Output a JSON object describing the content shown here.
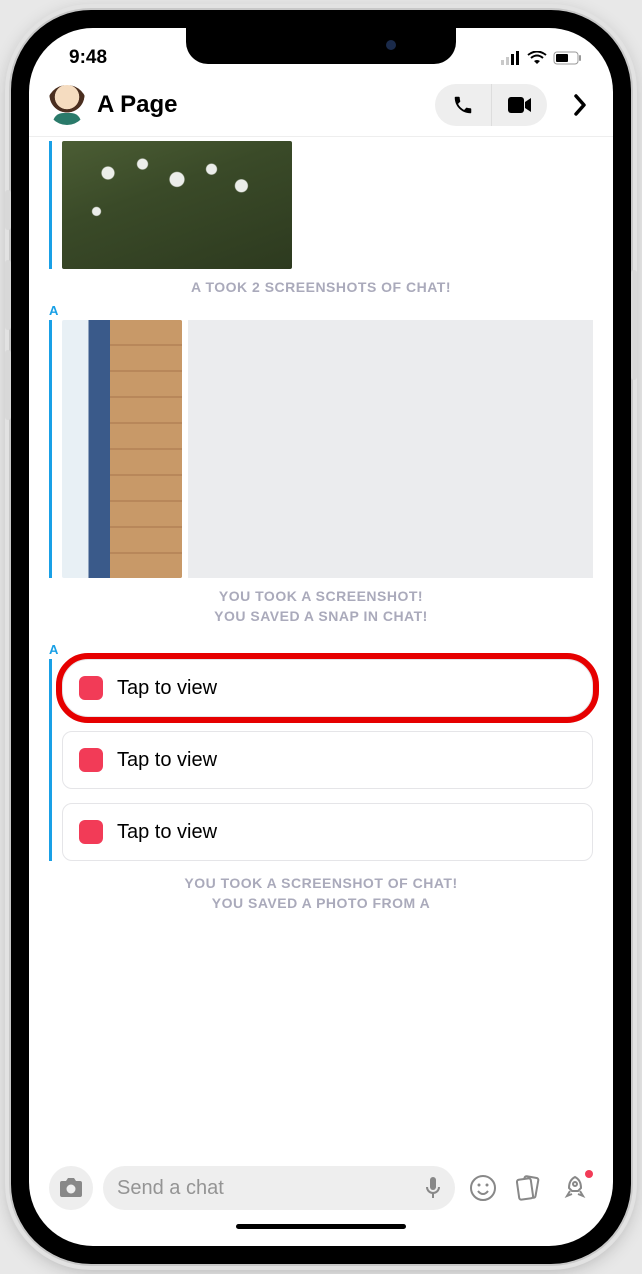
{
  "status": {
    "time": "9:48"
  },
  "header": {
    "name": "A Page"
  },
  "chat": {
    "sys1": "A TOOK 2 SCREENSHOTS OF CHAT!",
    "senderA": "A",
    "sys2a": "YOU TOOK A SCREENSHOT!",
    "sys2b": "YOU SAVED A SNAP IN CHAT!",
    "snaps": [
      {
        "label": "Tap to view"
      },
      {
        "label": "Tap to view"
      },
      {
        "label": "Tap to view"
      }
    ],
    "sys3a": "YOU TOOK A SCREENSHOT OF CHAT!",
    "sys3b": "YOU SAVED A PHOTO FROM A"
  },
  "footer": {
    "placeholder": "Send a chat"
  }
}
